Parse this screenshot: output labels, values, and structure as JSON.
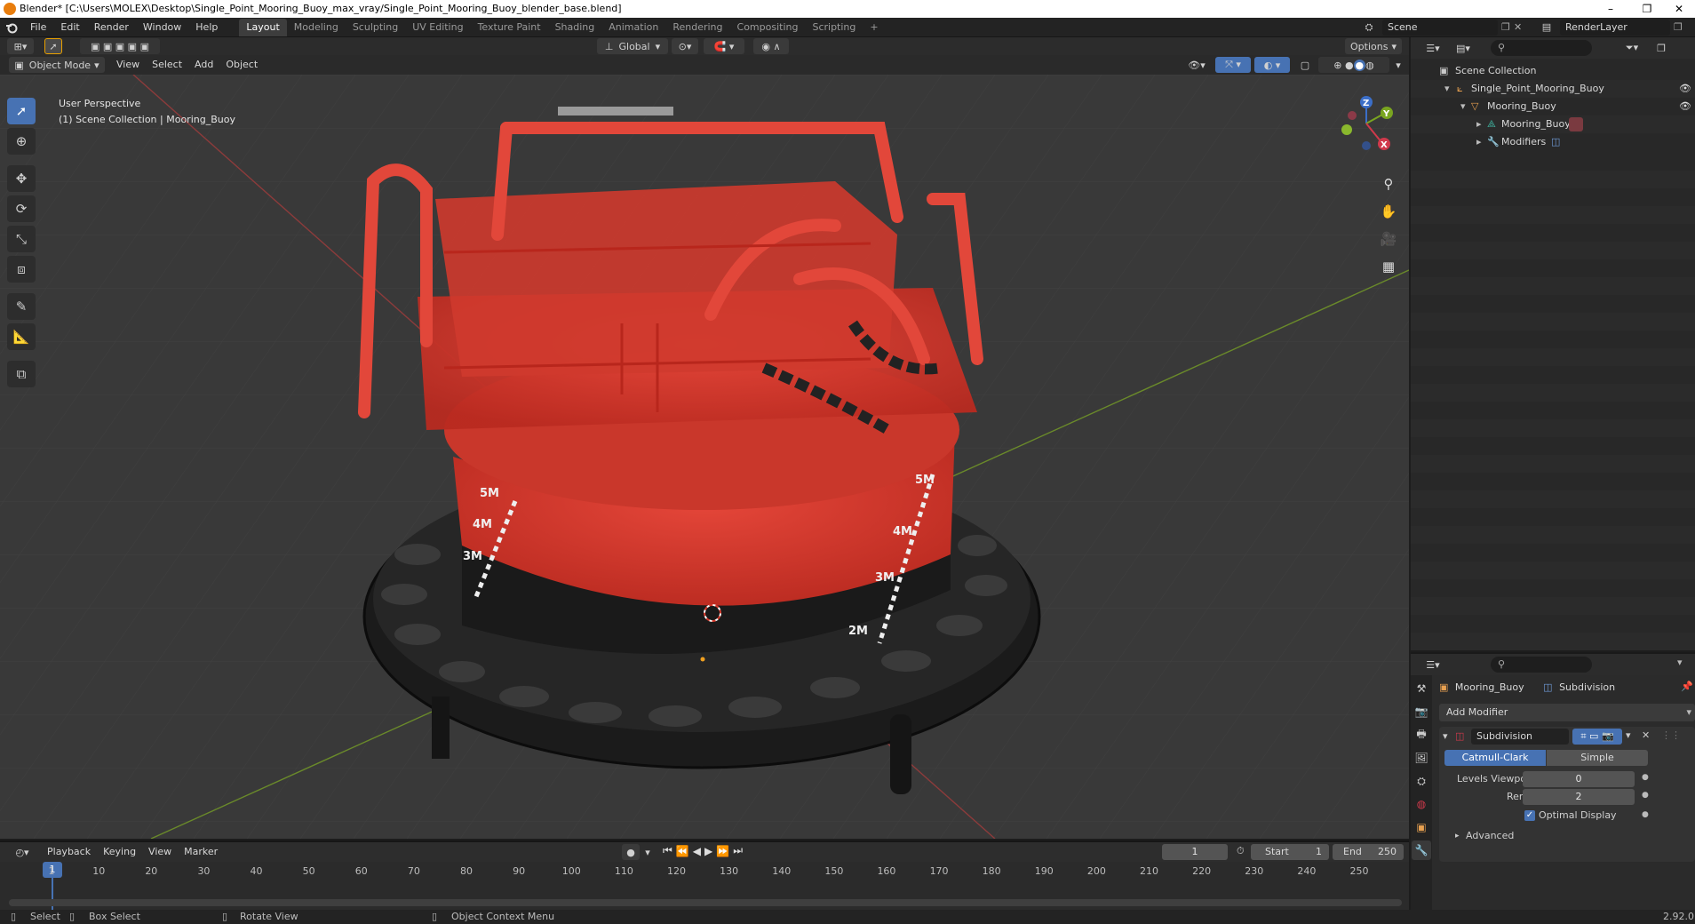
{
  "window": {
    "title": "Blender* [C:\\Users\\MOLEX\\Desktop\\Single_Point_Mooring_Buoy_max_vray/Single_Point_Mooring_Buoy_blender_base.blend]",
    "minimize": "–",
    "maximize": "❐",
    "close": "✕"
  },
  "menu": {
    "items": [
      "File",
      "Edit",
      "Render",
      "Window",
      "Help"
    ],
    "workspaces": [
      "Layout",
      "Modeling",
      "Sculpting",
      "UV Editing",
      "Texture Paint",
      "Shading",
      "Animation",
      "Rendering",
      "Compositing",
      "Scripting"
    ],
    "add_workspace": "+",
    "scene": "Scene",
    "render_layer": "RenderLayer"
  },
  "viewport_header": {
    "transform_orientation": "Global",
    "options": "Options",
    "mode": "Object Mode",
    "menus": [
      "View",
      "Select",
      "Add",
      "Object"
    ]
  },
  "viewport": {
    "perspective": "User Perspective",
    "collection_info": "(1) Scene Collection | Mooring_Buoy",
    "markings": [
      "5M",
      "4M",
      "3M",
      "5M",
      "4M",
      "3M",
      "2M"
    ],
    "gizmo": {
      "x": "X",
      "y": "Y",
      "z": "Z"
    }
  },
  "outliner": {
    "rows": [
      {
        "label": "Scene Collection"
      },
      {
        "label": "Single_Point_Mooring_Buoy"
      },
      {
        "label": "Mooring_Buoy"
      },
      {
        "label": "Mooring_Buoy"
      },
      {
        "label": "Modifiers"
      }
    ]
  },
  "properties": {
    "object_name": "Mooring_Buoy",
    "modifier_name_header": "Subdivision",
    "add_modifier": "Add Modifier",
    "modifier_name": "Subdivision",
    "algorithms": [
      "Catmull-Clark",
      "Simple"
    ],
    "levels_viewport_label": "Levels Viewport",
    "levels_viewport_value": "0",
    "render_label": "Render",
    "render_value": "2",
    "optimal_display": "Optimal Display",
    "advanced": "Advanced"
  },
  "timeline": {
    "menus": [
      "Playback",
      "Keying",
      "View",
      "Marker"
    ],
    "current_frame": "1",
    "start_label": "Start",
    "start_value": "1",
    "end_label": "End",
    "end_value": "250",
    "ticks": [
      "1",
      "10",
      "20",
      "30",
      "40",
      "50",
      "60",
      "70",
      "80",
      "90",
      "100",
      "110",
      "120",
      "130",
      "140",
      "150",
      "160",
      "170",
      "180",
      "190",
      "200",
      "210",
      "220",
      "230",
      "240",
      "250"
    ]
  },
  "statusbar": {
    "select": "Select",
    "box_select": "Box Select",
    "rotate_view": "Rotate View",
    "context_menu": "Object Context Menu",
    "version": "2.92.0"
  },
  "colors": {
    "accent": "#4772b3",
    "buoy_red": "#d63a2c",
    "buoy_black": "#1b1b1b",
    "orange": "#e87d0d"
  }
}
